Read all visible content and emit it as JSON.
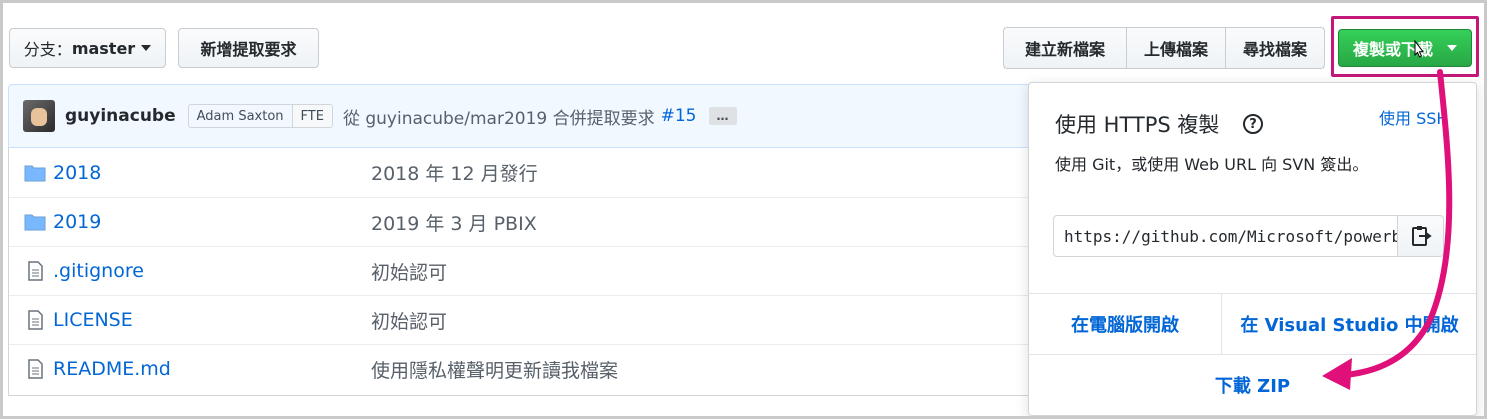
{
  "toolbar": {
    "branch_label": "分支：",
    "branch_name": "master",
    "new_pr_label": "新增提取要求",
    "create_file_label": "建立新檔案",
    "upload_label": "上傳檔案",
    "find_file_label": "尋找檔案",
    "clone_label": "複製或下載"
  },
  "commit": {
    "author": "guyinacube",
    "coauthor": "Adam Saxton",
    "coauthor_tag": "FTE",
    "message": "從 guyinacube/mar2019 合併提取要求",
    "pr_number": "#15",
    "ellipsis": "…"
  },
  "files": [
    {
      "name": "2018",
      "message": "2018 年 12 月發行",
      "icon": "folder-icon"
    },
    {
      "name": "2019",
      "message": "2019 年 3 月 PBIX",
      "icon": "folder-icon"
    },
    {
      "name": ".gitignore",
      "message": "初始認可",
      "icon": "file-icon"
    },
    {
      "name": "LICENSE",
      "message": "初始認可",
      "icon": "file-icon"
    },
    {
      "name": "README.md",
      "message": "使用隱私權聲明更新讀我檔案",
      "icon": "file-icon"
    }
  ],
  "clone_dropdown": {
    "title": "使用 HTTPS 複製",
    "help": "?",
    "use_ssh": "使用 SSH",
    "description": "使用 Git，或使用 Web URL 向 SVN 簽出。",
    "url": "https://github.com/Microsoft/powerbi-desktop-samples.git",
    "open_desktop": "在電腦版開啟",
    "open_vs": "在 Visual Studio 中開啟",
    "download_zip": "下載 ZIP"
  },
  "colors": {
    "accent_link": "#0366d6",
    "green_button": "#28a745",
    "highlight_magenta": "#e0107a"
  }
}
